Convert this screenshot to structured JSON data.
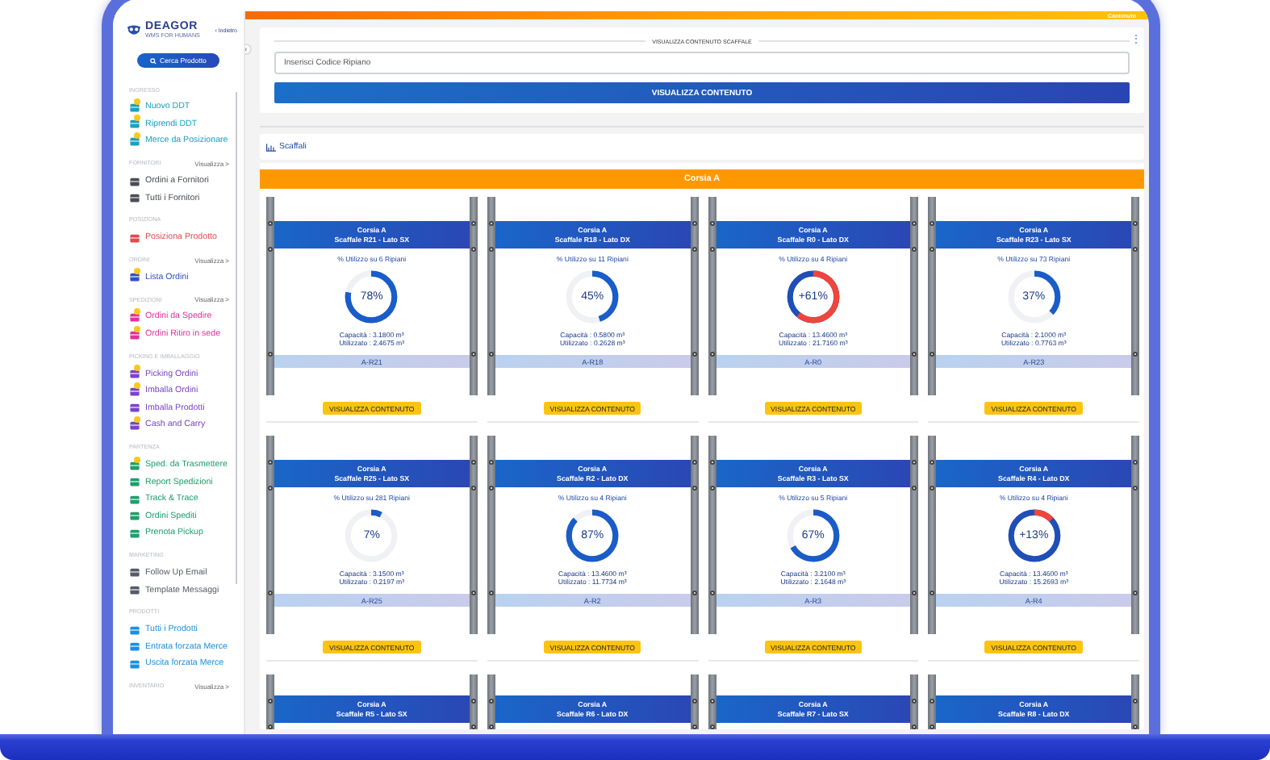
{
  "top_bar": {
    "text": "Contenuto"
  },
  "sidebar": {
    "logo": "DEAGOR",
    "tagline": "WMS FOR HUMANS",
    "back_link": "‹ Indietro",
    "search_button": "Cerca Prodotto",
    "sections": [
      {
        "title": "INGRESSO",
        "color": "#17a2c0",
        "items": [
          {
            "label": "Nuovo DDT",
            "badge": true
          },
          {
            "label": "Riprendi DDT",
            "badge": true
          },
          {
            "label": "Merce da Posizionare",
            "badge": true
          }
        ]
      },
      {
        "title": "FORNITORI",
        "link": "Visualizza >",
        "color": "#4a4d57",
        "items": [
          {
            "label": "Ordini a Fornitori",
            "badge": false
          },
          {
            "label": "Tutti i Fornitori",
            "badge": false
          }
        ]
      },
      {
        "title": "POSIZIONA",
        "color": "#e5484d",
        "items": [
          {
            "label": "Posiziona Prodotto",
            "badge": false
          }
        ]
      },
      {
        "title": "ORDINI",
        "link": "Visualizza >",
        "color": "#3450c4",
        "items": [
          {
            "label": "Lista Ordini",
            "badge": true
          }
        ]
      },
      {
        "title": "SPEDIZIONI",
        "link": "Visualizza >",
        "color": "#e0329a",
        "items": [
          {
            "label": "Ordini da Spedire",
            "badge": true
          },
          {
            "label": "Ordini Ritiro in sede",
            "badge": true
          }
        ]
      },
      {
        "title": "PICKING E IMBALLAGGIO",
        "color": "#7a45c8",
        "items": [
          {
            "label": "Picking Ordini",
            "badge": true
          },
          {
            "label": "Imballa Ordini",
            "badge": true
          },
          {
            "label": "Imballa Prodotti",
            "badge": false
          },
          {
            "label": "Cash and Carry",
            "badge": true
          }
        ]
      },
      {
        "title": "PARTENZA",
        "color": "#1f9e6e",
        "items": [
          {
            "label": "Sped. da Trasmettere",
            "badge": true
          },
          {
            "label": "Report Spedizioni",
            "badge": false
          },
          {
            "label": "Track & Trace",
            "badge": false
          },
          {
            "label": "Ordini Spediti",
            "badge": false
          },
          {
            "label": "Prenota Pickup",
            "badge": false
          }
        ]
      },
      {
        "title": "MARKETING",
        "color": "#555c66",
        "items": [
          {
            "label": "Follow Up Email",
            "badge": false
          },
          {
            "label": "Template Messaggi",
            "badge": false
          }
        ]
      },
      {
        "title": "PRODOTTI",
        "color": "#1a8fe0",
        "items": [
          {
            "label": "Tutti i Prodotti",
            "badge": false
          },
          {
            "label": "Entrata forzata Merce",
            "badge": false
          },
          {
            "label": "Uscita forzata Merce",
            "badge": false
          }
        ]
      },
      {
        "title": "INVENTARIO",
        "link": "Visualizza >"
      }
    ]
  },
  "collapse_button": "‹",
  "search_card": {
    "legend": "VISUALIZZA CONTENUTO SCAFFALE",
    "placeholder": "Inserisci Codice Ripiano",
    "button": "VISUALIZZA CONTENUTO",
    "menu": "⋮"
  },
  "shelves_panel": {
    "title": "Scaffali",
    "aisle": "Corsia A",
    "shelves": [
      {
        "aisle": "Corsia A",
        "name": "Scaffale R21 - Lato SX",
        "usage_label": "% Utilizzo su 6 Ripiani",
        "percent": "78%",
        "level": 0.78,
        "over": false,
        "capacity": "Capacità : 3.1800 m³",
        "used": "Utilizzato : 2.4675 m³",
        "code": "A-R21",
        "button": "VISUALIZZA CONTENUTO"
      },
      {
        "aisle": "Corsia A",
        "name": "Scaffale R18 - Lato DX",
        "usage_label": "% Utilizzo su 11 Ripiani",
        "percent": "45%",
        "level": 0.45,
        "over": false,
        "capacity": "Capacità : 0.5800 m³",
        "used": "Utilizzato : 0.2628 m³",
        "code": "A-R18",
        "button": "VISUALIZZA CONTENUTO"
      },
      {
        "aisle": "Corsia A",
        "name": "Scaffale R0 - Lato DX",
        "usage_label": "% Utilizzo su 4 Ripiani",
        "percent": "+61%",
        "level": 0.61,
        "over": true,
        "capacity": "Capacità : 13.4600 m³",
        "used": "Utilizzato : 21.7160 m³",
        "code": "A-R0",
        "button": "VISUALIZZA CONTENUTO"
      },
      {
        "aisle": "Corsia A",
        "name": "Scaffale R23 - Lato SX",
        "usage_label": "% Utilizzo su 73 Ripiani",
        "percent": "37%",
        "level": 0.37,
        "over": false,
        "capacity": "Capacità : 2.1000 m³",
        "used": "Utilizzato : 0.7763 m³",
        "code": "A-R23",
        "button": "VISUALIZZA CONTENUTO"
      },
      {
        "aisle": "Corsia A",
        "name": "Scaffale R25 - Lato SX",
        "usage_label": "% Utilizzo su 281 Ripiani",
        "percent": "7%",
        "level": 0.07,
        "over": false,
        "capacity": "Capacità : 3.1500 m³",
        "used": "Utilizzato : 0.2197 m³",
        "code": "A-R25",
        "button": "VISUALIZZA CONTENUTO"
      },
      {
        "aisle": "Corsia A",
        "name": "Scaffale R2 - Lato DX",
        "usage_label": "% Utilizzo su 4 Ripiani",
        "percent": "87%",
        "level": 0.87,
        "over": false,
        "capacity": "Capacità : 13.4600 m³",
        "used": "Utilizzato : 11.7734 m³",
        "code": "A-R2",
        "button": "VISUALIZZA CONTENUTO"
      },
      {
        "aisle": "Corsia A",
        "name": "Scaffale R3 - Lato SX",
        "usage_label": "% Utilizzo su 5 Ripiani",
        "percent": "67%",
        "level": 0.67,
        "over": false,
        "capacity": "Capacità : 3.2100 m³",
        "used": "Utilizzato : 2.1648 m³",
        "code": "A-R3",
        "button": "VISUALIZZA CONTENUTO"
      },
      {
        "aisle": "Corsia A",
        "name": "Scaffale R4 - Lato DX",
        "usage_label": "% Utilizzo su 4 Ripiani",
        "percent": "+13%",
        "level": 0.13,
        "over": true,
        "capacity": "Capacità : 13.4600 m³",
        "used": "Utilizzato : 15.2693 m³",
        "code": "A-R4",
        "button": "VISUALIZZA CONTENUTO"
      }
    ],
    "partial_shelves": [
      {
        "aisle": "Corsia A",
        "name": "Scaffale R5 - Lato SX"
      },
      {
        "aisle": "Corsia A",
        "name": "Scaffale R6 - Lato DX"
      },
      {
        "aisle": "Corsia A",
        "name": "Scaffale R7 - Lato SX"
      },
      {
        "aisle": "Corsia A",
        "name": "Scaffale R8 - Lato DX"
      }
    ]
  }
}
